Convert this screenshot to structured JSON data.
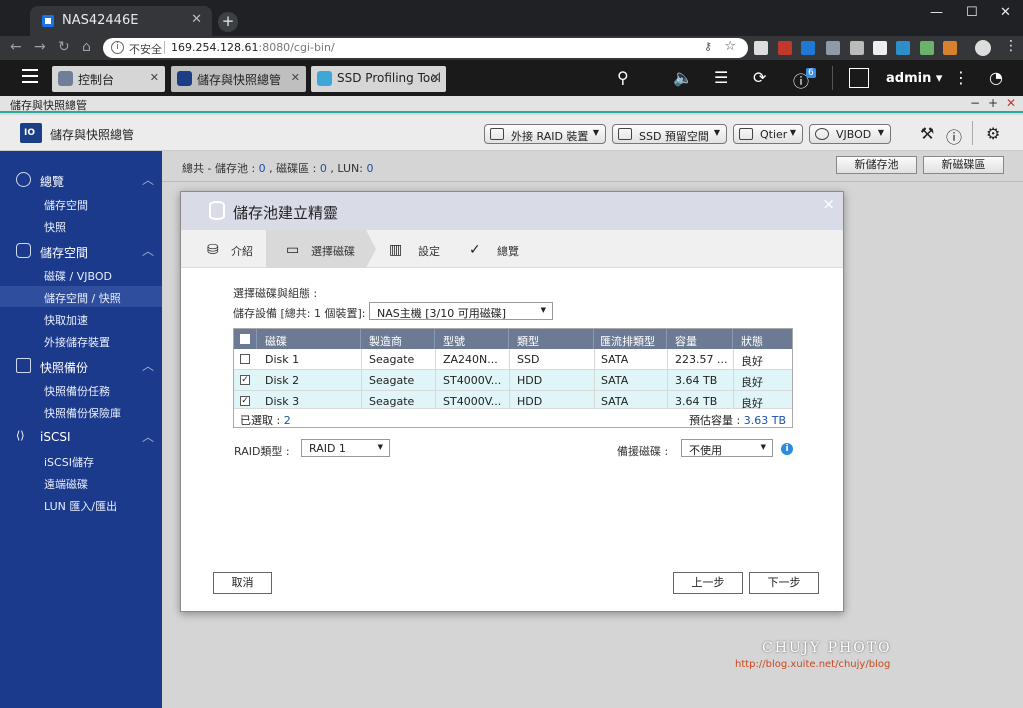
{
  "browser": {
    "tab_title": "NAS42446E",
    "security_label": "不安全",
    "url_host": "169.254.128.61",
    "url_path": ":8080/cgi-bin/",
    "window_min": "—",
    "window_max": "☐",
    "window_close": "✕"
  },
  "qts": {
    "tabs": [
      {
        "label": "控制台",
        "icon_color": "#6f7f95"
      },
      {
        "label": "儲存與快照總管",
        "icon_color": "#1b3f86"
      },
      {
        "label": "SSD Profiling Tool",
        "icon_color": "#3fa6d8"
      }
    ],
    "notification_count": "6",
    "user": "admin"
  },
  "app": {
    "title_bar": "儲存與快照總管",
    "name": "儲存與快照總管",
    "header_buttons": [
      "外接 RAID 裝置",
      "SSD 預留空間",
      "Qtier",
      "VJBOD"
    ]
  },
  "sidebar": {
    "sections": [
      {
        "label": "總覽",
        "items": [
          "儲存空間",
          "快照"
        ]
      },
      {
        "label": "儲存空間",
        "items": [
          "磁碟 / VJBOD",
          "儲存空間 / 快照",
          "快取加速",
          "外接儲存裝置"
        ]
      },
      {
        "label": "快照備份",
        "items": [
          "快照備份任務",
          "快照備份保險庫"
        ]
      },
      {
        "label": "iSCSI",
        "items": [
          "iSCSI儲存",
          "遠端磁碟",
          "LUN 匯入/匯出"
        ]
      }
    ],
    "active_item": "儲存空間 / 快照"
  },
  "main": {
    "summary_prefix": "總共 - 儲存池 :",
    "pool_count": "0",
    "disk_label": ", 磁碟區 :",
    "disk_count": "0",
    "lun_label": ", LUN:",
    "lun_count": "0",
    "new_pool_button": "新儲存池",
    "new_volume_button": "新磁碟區"
  },
  "dialog": {
    "title": "儲存池建立精靈",
    "close": "×",
    "steps": [
      "介紹",
      "選擇磁碟",
      "設定",
      "總覽"
    ],
    "active_step": "選擇磁碟",
    "select_prompt": "選擇磁碟與組態 :",
    "device_label": "儲存設備 [總共: 1 個裝置]:",
    "device_value": "NAS主機 [3/10 可用磁碟]",
    "columns": [
      "磁碟",
      "製造商",
      "型號",
      "類型",
      "匯流排類型",
      "容量",
      "狀態"
    ],
    "rows": [
      {
        "checked": false,
        "disk": "Disk 1",
        "vendor": "Seagate",
        "model": "ZA240N...",
        "type": "SSD",
        "bus": "SATA",
        "capacity": "223.57 ...",
        "status": "良好"
      },
      {
        "checked": true,
        "disk": "Disk 2",
        "vendor": "Seagate",
        "model": "ST4000V...",
        "type": "HDD",
        "bus": "SATA",
        "capacity": "3.64 TB",
        "status": "良好"
      },
      {
        "checked": true,
        "disk": "Disk 3",
        "vendor": "Seagate",
        "model": "ST4000V...",
        "type": "HDD",
        "bus": "SATA",
        "capacity": "3.64 TB",
        "status": "良好"
      }
    ],
    "selected_label": "已選取 :",
    "selected_count": "2",
    "estimated_label": "預估容量 :",
    "estimated_value": "3.63 TB",
    "raid_label": "RAID類型 :",
    "raid_value": "RAID 1",
    "spare_label": "備援磁碟 :",
    "spare_value": "不使用",
    "cancel": "取消",
    "prev": "上一步",
    "next": "下一步"
  },
  "watermark": {
    "line1": "CHUJY PHOTO",
    "line2": "http://blog.xuite.net/chujy/blog"
  }
}
